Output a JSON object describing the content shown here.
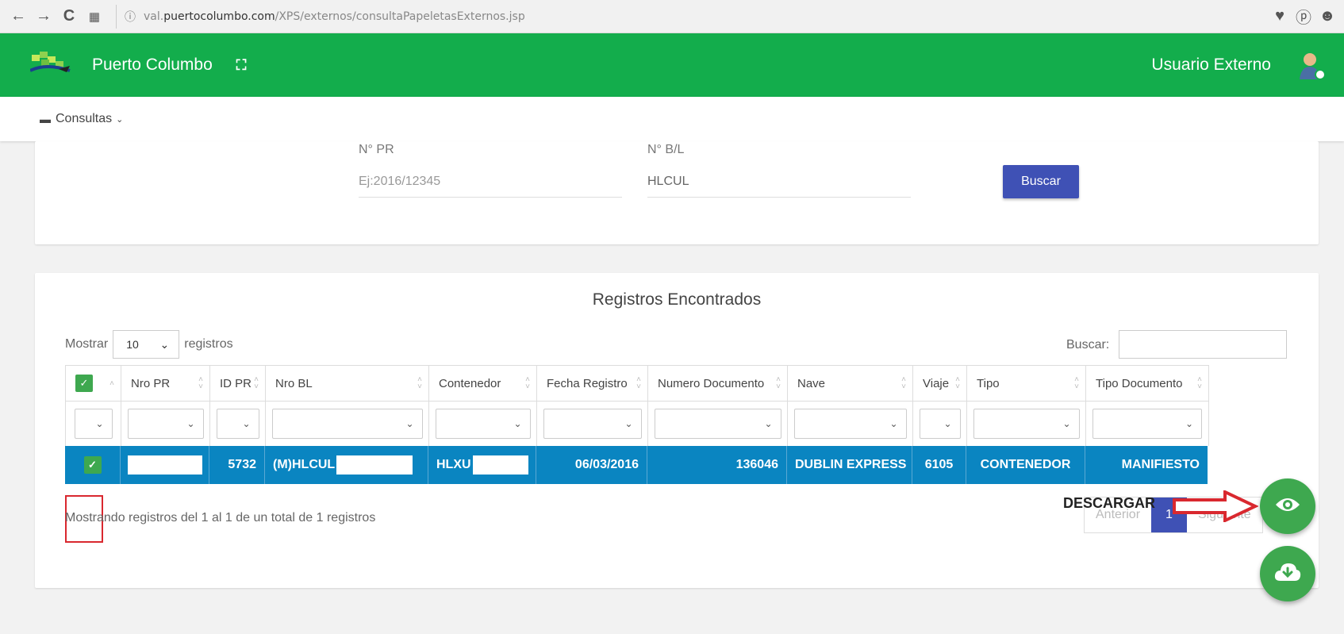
{
  "browser": {
    "url_prefix": "val.",
    "url_domain": "puertocolumbo.com",
    "url_path": "/XPS/externos/consultaPapeletasExternos.jsp"
  },
  "header": {
    "brand": "Puerto Columbo",
    "user": "Usuario Externo",
    "color": "#13ad4c"
  },
  "menu": {
    "consultas": "Consultas"
  },
  "search": {
    "pr_label": "N° PR",
    "pr_placeholder": "Ej:2016/12345",
    "bl_label": "N° B/L",
    "bl_value": "HLCUL",
    "button": "Buscar"
  },
  "results": {
    "title": "Registros Encontrados",
    "show_label": "Mostrar",
    "show_value": "10",
    "records_label": "registros",
    "search_label": "Buscar:",
    "columns": [
      "Nro PR",
      "ID PR",
      "Nro BL",
      "Contenedor",
      "Fecha Registro",
      "Numero Documento",
      "Nave",
      "Viaje",
      "Tipo",
      "Tipo Documento"
    ],
    "row": {
      "nro_pr": "",
      "id_pr": "5732",
      "nro_bl": "(M)HLCUL",
      "contenedor": "HLXU",
      "fecha": "06/03/2016",
      "numero_documento": "136046",
      "nave": "DUBLIN EXPRESS",
      "viaje": "6105",
      "tipo": "CONTENEDOR",
      "tipo_documento": "MANIFIESTO"
    },
    "info": "Mostrando registros del 1 al 1 de un total de 1 registros",
    "pager": {
      "prev": "Anterior",
      "page": "1",
      "next": "Siguiente"
    }
  },
  "annotation": {
    "label": "DESCARGAR"
  }
}
